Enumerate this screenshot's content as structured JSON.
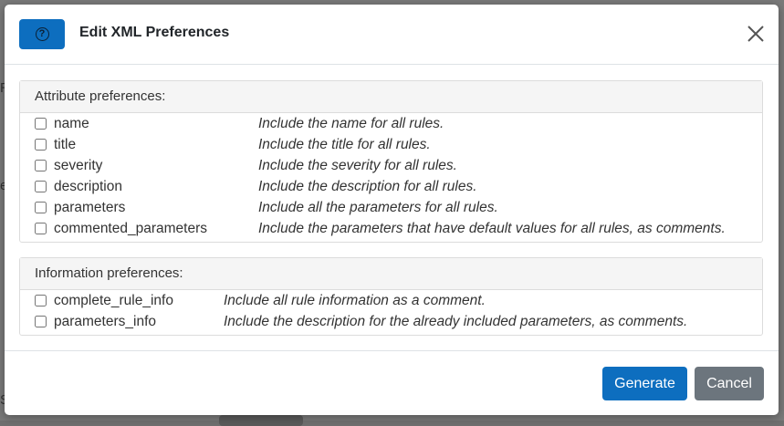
{
  "background": {
    "fragments": [
      "e",
      "R",
      "S"
    ]
  },
  "dialog": {
    "title": "Edit XML Preferences",
    "help_icon": "question-circle-icon",
    "close_icon": "close-x-icon"
  },
  "attribute_prefs": {
    "heading": "Attribute preferences:",
    "items": [
      {
        "name": "name",
        "desc": "Include the name for all rules.",
        "checked": false
      },
      {
        "name": "title",
        "desc": "Include the title for all rules.",
        "checked": false
      },
      {
        "name": "severity",
        "desc": "Include the severity for all rules.",
        "checked": false
      },
      {
        "name": "description",
        "desc": "Include the description for all rules.",
        "checked": false
      },
      {
        "name": "parameters",
        "desc": "Include all the parameters for all rules.",
        "checked": false
      },
      {
        "name": "commented_parameters",
        "desc": "Include the parameters that have default values for all rules, as comments.",
        "checked": false
      }
    ]
  },
  "info_prefs": {
    "heading": "Information preferences:",
    "items": [
      {
        "name": "complete_rule_info",
        "desc": "Include all rule information as a comment.",
        "checked": false
      },
      {
        "name": "parameters_info",
        "desc": "Include the description for the already included parameters, as comments.",
        "checked": false
      }
    ]
  },
  "footer": {
    "generate_label": "Generate",
    "cancel_label": "Cancel"
  },
  "colors": {
    "primary": "#0d6ebf",
    "secondary": "#6c757d",
    "panel_header_bg": "#f5f5f5"
  }
}
